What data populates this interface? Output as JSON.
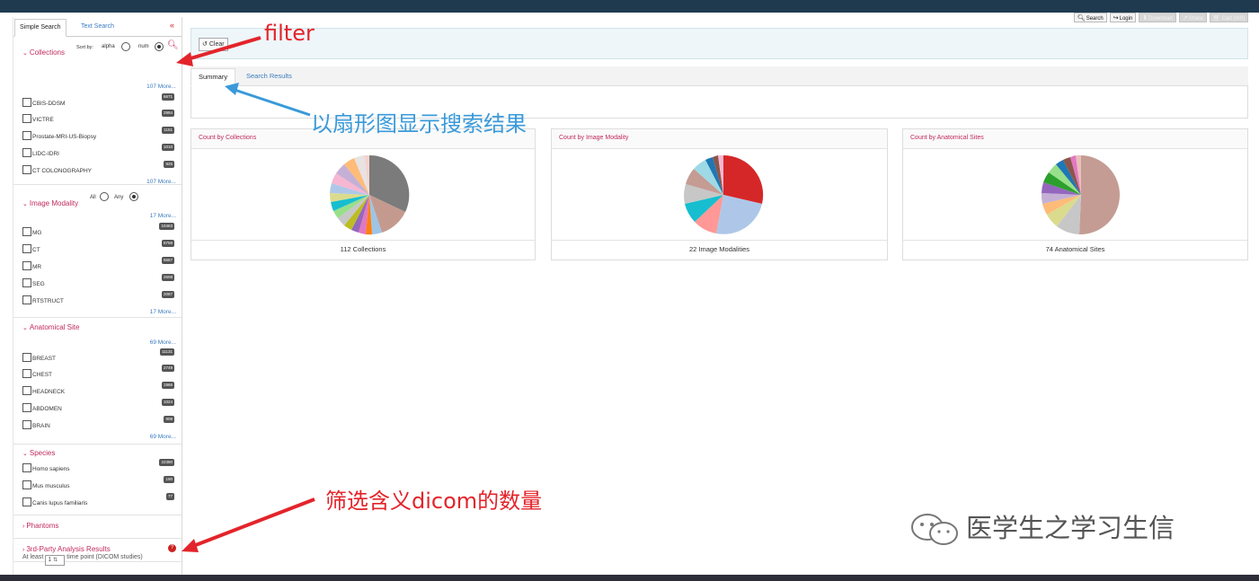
{
  "toolbar": {
    "search": "Search",
    "login": "Login",
    "download": "Download",
    "share": "Share",
    "cart": "Cart",
    "cart_count": "(0/0)"
  },
  "sidebar": {
    "tabs": [
      "Simple Search",
      "Text Search"
    ],
    "collections": {
      "title": "Collections",
      "sort_by": "Sort by:",
      "alpha": "alpha",
      "num": "num",
      "more": "107 More...",
      "items": [
        {
          "label": "CBIS-DDSM",
          "count": "6671"
        },
        {
          "label": "VICTRE",
          "count": "2994"
        },
        {
          "label": "Prostate-MRI-US-Biopsy",
          "count": "1151"
        },
        {
          "label": "LIDC-IDRI",
          "count": "1010"
        },
        {
          "label": "CT COLONOGRAPHY",
          "count": "825"
        }
      ]
    },
    "modality": {
      "title": "Image Modality",
      "all": "All",
      "any": "Any",
      "more": "17 More...",
      "items": [
        {
          "label": "MG",
          "count": "10463"
        },
        {
          "label": "CT",
          "count": "8758"
        },
        {
          "label": "MR",
          "count": "5667"
        },
        {
          "label": "SEG",
          "count": "2608"
        },
        {
          "label": "RTSTRUCT",
          "count": "2087"
        }
      ]
    },
    "anatomical": {
      "title": "Anatomical Site",
      "more": "69 More...",
      "items": [
        {
          "label": "BREAST",
          "count": "11131"
        },
        {
          "label": "CHEST",
          "count": "2749"
        },
        {
          "label": "HEADNECK",
          "count": "1966"
        },
        {
          "label": "ABDOMEN",
          "count": "1024"
        },
        {
          "label": "BRAIN",
          "count": "908"
        }
      ]
    },
    "species": {
      "title": "Species",
      "items": [
        {
          "label": "Homo sapiens",
          "count": "22380"
        },
        {
          "label": "Mus musculus",
          "count": "190"
        },
        {
          "label": "Canis lupus familiaris",
          "count": "77"
        }
      ]
    },
    "phantoms": "Phantoms",
    "third_party": "3rd-Party Analysis Results",
    "at_least": "At least",
    "time_value": "1",
    "time_point": "time point (DICOM studies)"
  },
  "main": {
    "clear": "Clear",
    "tabs": [
      "Summary",
      "Search Results"
    ],
    "panels": [
      {
        "title": "Count by Collections",
        "footer": "112 Collections"
      },
      {
        "title": "Count by Image Modality",
        "footer": "22 Image Modalities"
      },
      {
        "title": "Count by Anatomical Sites",
        "footer": "74 Anatomical Sites"
      }
    ]
  },
  "annotations": {
    "filter": "filter",
    "pie_note": "以扇形图显示搜索结果",
    "count_note": "筛选含义dicom的数量"
  },
  "watermark": "医学生之学习生信",
  "colors": {
    "accent": "#c12a5e",
    "link": "#3b7bbf",
    "annotation_red": "#e3242b",
    "annotation_blue": "#3a9ad9"
  }
}
